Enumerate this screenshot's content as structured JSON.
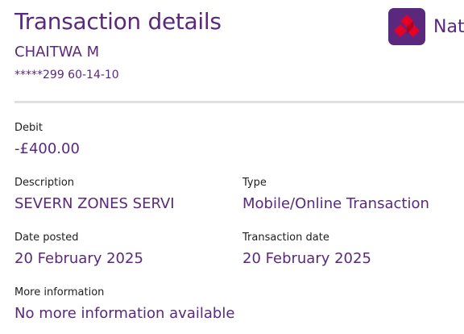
{
  "header": {
    "title": "Transaction details",
    "account_name": "CHAITWA M",
    "account_number": "*****299 60-14-10"
  },
  "brand": {
    "name": "NatW",
    "logo_icon": "natwest-cube-logo",
    "logo_bg": "#5a287d",
    "logo_red": "#e60028"
  },
  "colors": {
    "accent": "#5a287d",
    "label": "#1d1d1d",
    "divider": "#e0e0e0"
  },
  "transaction": {
    "debit_label": "Debit",
    "debit_value": "-£400.00",
    "description_label": "Description",
    "description_value": "SEVERN ZONES SERVI",
    "type_label": "Type",
    "type_value": "Mobile/Online Transaction",
    "date_posted_label": "Date posted",
    "date_posted_value": "20 February 2025",
    "transaction_date_label": "Transaction date",
    "transaction_date_value": "20 February 2025",
    "more_info_label": "More information",
    "more_info_value": "No more information available"
  }
}
